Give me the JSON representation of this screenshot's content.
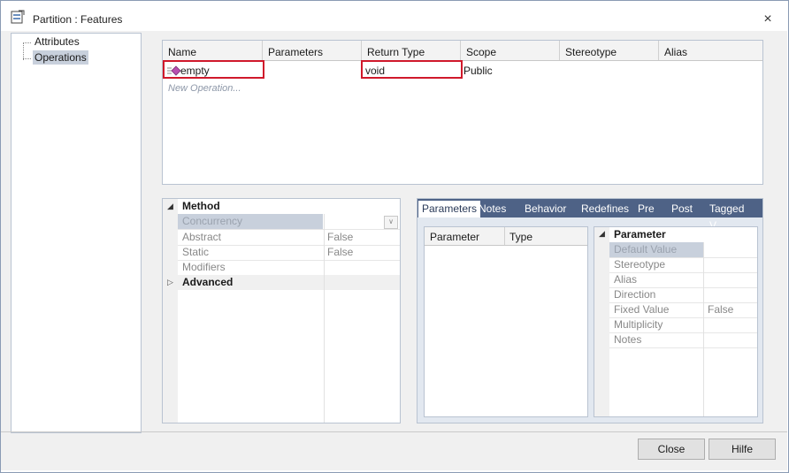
{
  "window": {
    "title": "Partition : Features",
    "close_glyph": "×"
  },
  "tree": {
    "items": [
      {
        "label": "Attributes"
      },
      {
        "label": "Operations",
        "selected": true
      }
    ]
  },
  "operations_grid": {
    "columns": [
      "Name",
      "Parameters",
      "Return Type",
      "Scope",
      "Stereotype",
      "Alias"
    ],
    "rows": [
      {
        "name": "empty",
        "parameters": "",
        "return_type": "void",
        "scope": "Public",
        "stereotype": "",
        "alias": ""
      }
    ],
    "new_row_placeholder": "New Operation..."
  },
  "method_props": {
    "group_method": "Method",
    "group_advanced": "Advanced",
    "rows": [
      {
        "label": "Concurrency",
        "value": ""
      },
      {
        "label": "Abstract",
        "value": "False"
      },
      {
        "label": "Static",
        "value": "False"
      },
      {
        "label": "Modifiers",
        "value": ""
      }
    ]
  },
  "tabs": [
    "Parameters",
    "Notes",
    "Behavior",
    "Redefines",
    "Pre",
    "Post",
    "Tagged V..."
  ],
  "params_list": {
    "columns": [
      "Parameter",
      "Type"
    ]
  },
  "param_props": {
    "group": "Parameter",
    "rows": [
      {
        "label": "Default Value",
        "value": ""
      },
      {
        "label": "Stereotype",
        "value": ""
      },
      {
        "label": "Alias",
        "value": ""
      },
      {
        "label": "Direction",
        "value": ""
      },
      {
        "label": "Fixed Value",
        "value": "False"
      },
      {
        "label": "Multiplicity",
        "value": ""
      },
      {
        "label": "Notes",
        "value": ""
      }
    ]
  },
  "buttons": {
    "close": "Close",
    "help": "Hilfe"
  },
  "colors": {
    "highlight": "#d0192b",
    "tab_strip": "#4e6286",
    "selected_bg": "#c8d0dc"
  }
}
